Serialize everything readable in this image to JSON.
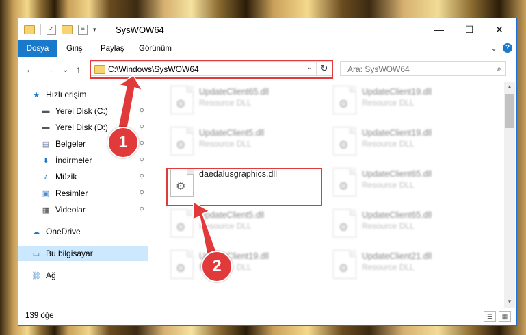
{
  "window": {
    "title": "SysWOW64",
    "minimize_glyph": "—",
    "maximize_glyph": "☐",
    "close_glyph": "✕"
  },
  "ribbon": {
    "tabs": [
      "Dosya",
      "Giriş",
      "Paylaş",
      "Görünüm"
    ],
    "collapse_glyph": "⌄",
    "help_glyph": "?"
  },
  "nav": {
    "back_glyph": "←",
    "forward_glyph": "→",
    "recent_glyph": "⌄",
    "up_glyph": "↑",
    "address": "C:\\Windows\\SysWOW64",
    "dropdown_glyph": "⌄",
    "refresh_glyph": "↻",
    "search_placeholder": "Ara: SysWOW64",
    "search_glyph": "⌕"
  },
  "sidebar": {
    "items": [
      {
        "label": "Hızlı erişim",
        "icon": "star-icon",
        "glyph": "★",
        "pinned": false
      },
      {
        "label": "Yerel Disk (C:)",
        "icon": "drive-icon",
        "glyph": "▬",
        "pinned": true
      },
      {
        "label": "Yerel Disk (D:)",
        "icon": "drive-icon",
        "glyph": "▬",
        "pinned": true
      },
      {
        "label": "Belgeler",
        "icon": "documents-icon",
        "glyph": "▤",
        "pinned": true
      },
      {
        "label": "İndirmeler",
        "icon": "download-icon",
        "glyph": "⬇",
        "pinned": true
      },
      {
        "label": "Müzik",
        "icon": "music-icon",
        "glyph": "♪",
        "pinned": true
      },
      {
        "label": "Resimler",
        "icon": "pictures-icon",
        "glyph": "▣",
        "pinned": true
      },
      {
        "label": "Videolar",
        "icon": "video-icon",
        "glyph": "▦",
        "pinned": true
      },
      {
        "label": "OneDrive",
        "icon": "cloud-icon",
        "glyph": "☁",
        "pinned": false
      },
      {
        "label": "Bu bilgisayar",
        "icon": "computer-icon",
        "glyph": "▭",
        "pinned": false
      },
      {
        "label": "Ağ",
        "icon": "network-icon",
        "glyph": "⛓",
        "pinned": false
      }
    ],
    "pin_glyph": "📌"
  },
  "files": [
    {
      "name": "UpdateClient65.dll",
      "desc": "Resource DLL"
    },
    {
      "name": "UpdateClient19.dll",
      "desc": "Resource DLL"
    },
    {
      "name": "UpdateClient5.dll",
      "desc": "Resource DLL"
    },
    {
      "name": "UpdateClient19.dll",
      "desc": "Resource DLL"
    },
    {
      "name": "daedalusgraphics.dll",
      "desc": ""
    },
    {
      "name": "UpdateClient65.dll",
      "desc": "Resource DLL"
    },
    {
      "name": "UpdateClient5.dll",
      "desc": "Resource DLL"
    },
    {
      "name": "UpdateClient65.dll",
      "desc": "Resource DLL"
    },
    {
      "name": "UpdateClient19.dll",
      "desc": "Resource DLL"
    },
    {
      "name": "UpdateClient21.dll",
      "desc": "Resource DLL"
    }
  ],
  "status": {
    "count": "139 öğe"
  },
  "callouts": [
    "1",
    "2"
  ],
  "colors": {
    "accent": "#1979ca",
    "highlight": "#e03a3a",
    "selected": "#cce8ff"
  }
}
